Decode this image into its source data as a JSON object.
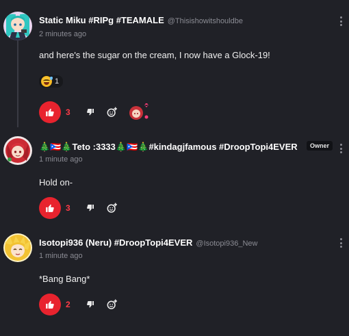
{
  "comments": [
    {
      "display_name": "Static Miku #RIPg #TEAMALE",
      "username": "@Thisishowitshouldbe",
      "timestamp": "2 minutes ago",
      "body": "and here's the sugar on the cream, I now have a Glock-19!",
      "reaction": {
        "emoji": "sweat-smile-emoji",
        "count": "1"
      },
      "likes": "3",
      "avatar": "anime-avatar-teal",
      "has_sticker": true
    },
    {
      "display_name": "🎄🇵🇷🎄Teto :3333🎄🇵🇷🎄#kindagjfamous #DroopTopi4EVER",
      "badge": "Owner",
      "timestamp": "1 minute ago",
      "body": "Hold on-",
      "likes": "3",
      "avatar": "anime-avatar-red"
    },
    {
      "display_name": "Isotopi936 (Neru) #DroopTopi4EVER",
      "username": "@Isotopi936_New",
      "timestamp": "1 minute ago",
      "body": "*Bang Bang*",
      "likes": "2",
      "avatar": "anime-avatar-yellow"
    }
  ],
  "icons": {
    "like": "thumbs-up-icon",
    "dislike": "thumbs-down-icon",
    "add_reaction": "add-emoji-icon",
    "more": "more-vertical-icon"
  },
  "colors": {
    "background": "#202127",
    "like_accent": "#e8232e",
    "like_count": "#ff3b47",
    "muted_text": "#8b8c94"
  }
}
